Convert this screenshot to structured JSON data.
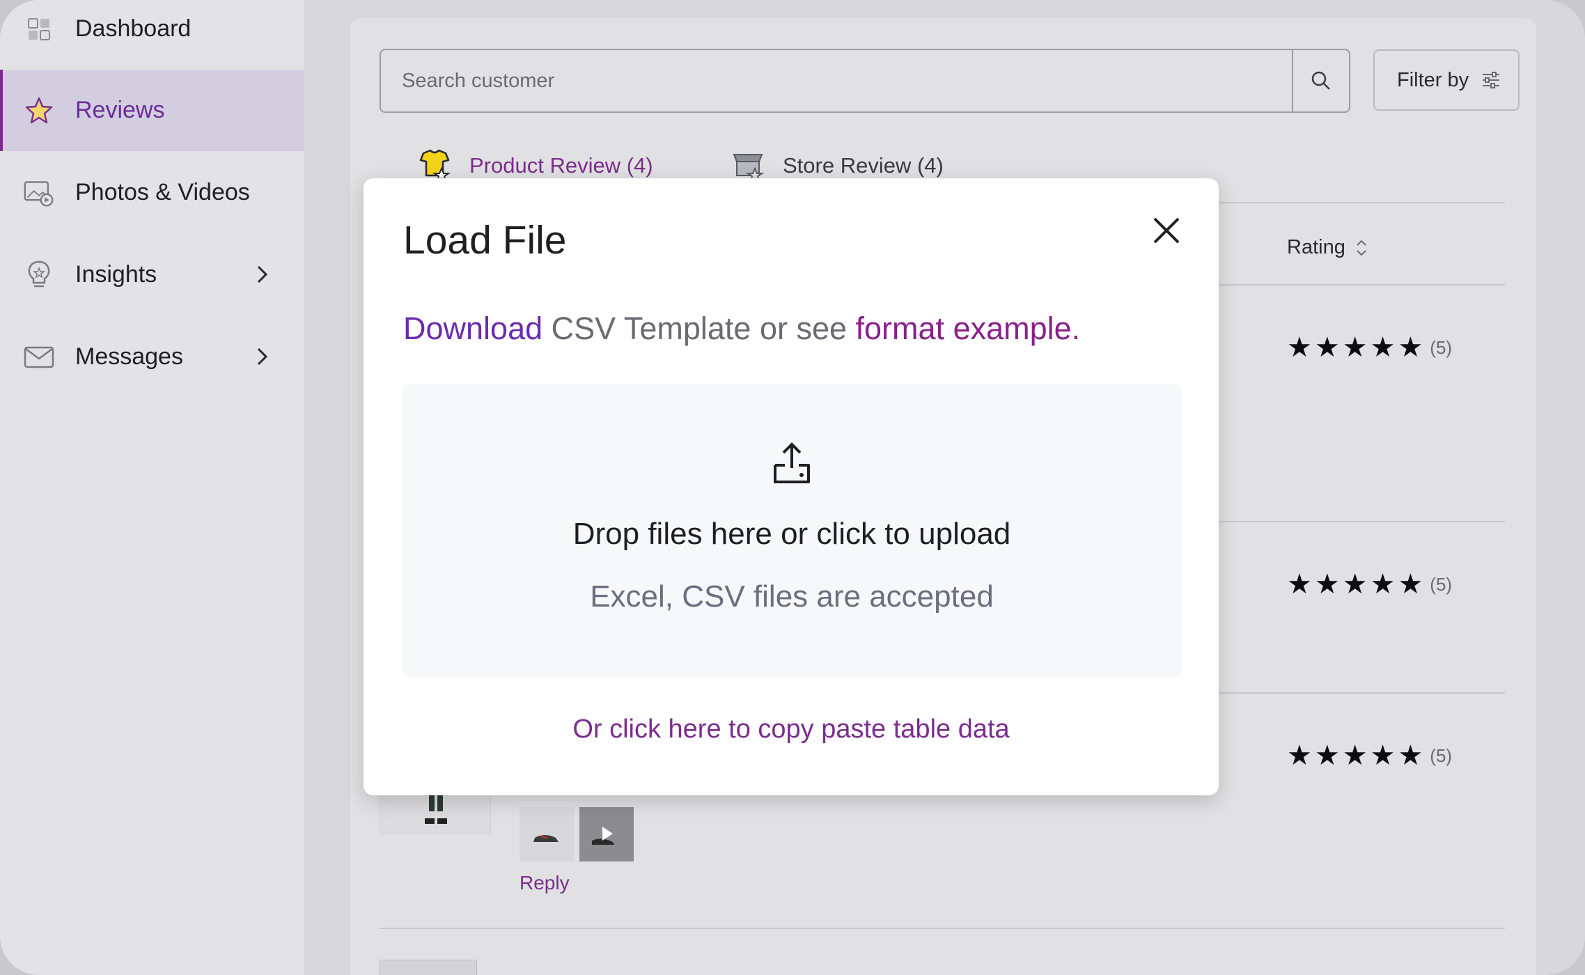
{
  "sidebar": {
    "items": [
      {
        "label": "Dashboard",
        "icon": "dashboard-icon",
        "active": false
      },
      {
        "label": "Reviews",
        "icon": "star-icon",
        "active": true
      },
      {
        "label": "Photos & Videos",
        "icon": "photo-video-icon",
        "active": false
      },
      {
        "label": "Insights",
        "icon": "lightbulb-icon",
        "active": false,
        "expandable": true
      },
      {
        "label": "Messages",
        "icon": "envelope-icon",
        "active": false,
        "expandable": true
      }
    ]
  },
  "main": {
    "search": {
      "placeholder": "Search customer"
    },
    "filter_label": "Filter by",
    "tabs": [
      {
        "label": "Product Review (4)",
        "active": true
      },
      {
        "label": "Store Review (4)",
        "active": false
      }
    ],
    "columns": {
      "rating": "Rating"
    },
    "reviews": [
      {
        "stars": "★★★★★",
        "count": "(5)"
      },
      {
        "stars": "★★★★★",
        "count": "(5)"
      },
      {
        "stars": "★★★★★",
        "count": "(5)"
      }
    ],
    "reply_label": "Reply"
  },
  "modal": {
    "title": "Load File",
    "download_link": "Download",
    "download_middle": " CSV Template or see ",
    "format_link": "format example.",
    "drop_title": "Drop files here or click to upload",
    "drop_subtitle": "Excel, CSV files are accepted",
    "paste_link": "Or click here to copy paste table data"
  },
  "colors": {
    "accent": "#7b2d8e",
    "download_link": "#6b2bb0",
    "sidebar_active_bg": "#d2cee0",
    "modal_bg": "#ffffff",
    "dropzone_bg": "#f7f8fa"
  }
}
